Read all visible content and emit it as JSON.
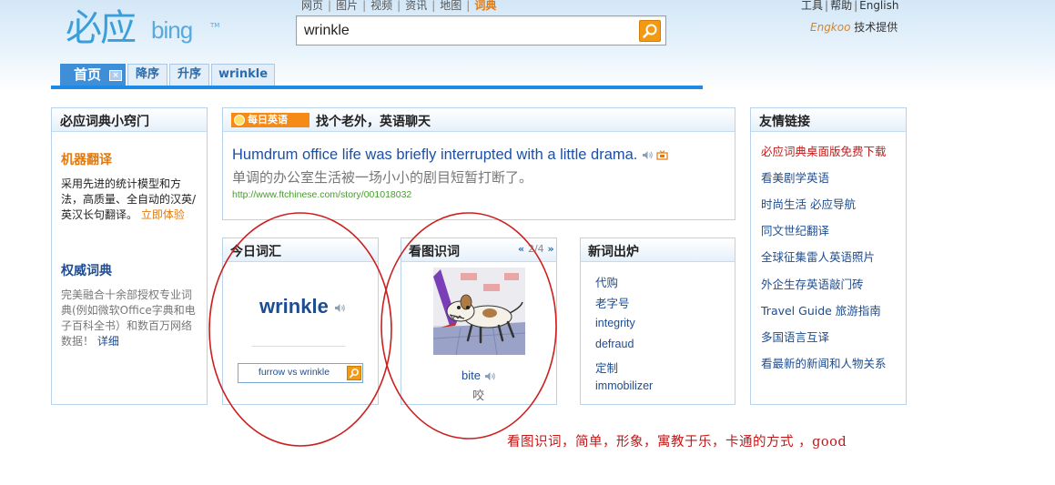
{
  "logo": {
    "cn": "必应",
    "en": "bing",
    "tm": "TM"
  },
  "nav": {
    "items": [
      {
        "label": "网页"
      },
      {
        "label": "图片"
      },
      {
        "label": "视频"
      },
      {
        "label": "资讯"
      },
      {
        "label": "地图"
      },
      {
        "label": "词典"
      }
    ],
    "active_index": 5
  },
  "search": {
    "value": "wrinkle"
  },
  "top_right": {
    "tools": "工具",
    "help": "帮助",
    "english": "English"
  },
  "provider": {
    "brand": "Engkoo",
    "text": "技术提供"
  },
  "tabs": {
    "home": "首页",
    "close": "×",
    "desc": "降序",
    "asc": "升序",
    "word": "wrinkle"
  },
  "left_panel": {
    "title": "必应词典小窍门",
    "mt_title": "机器翻译",
    "mt_desc": "采用先进的统计模型和方法，高质量、全自动的汉英/英汉长句翻译。",
    "mt_link": "立即体验",
    "auth_title": "权威词典",
    "auth_desc": "完美融合十余部授权专业词典(例如微软Office字典和电子百科全书）和数百万网络数据！",
    "auth_link": "详细"
  },
  "daily": {
    "badge": "每日英语",
    "title": "找个老外，英语聊天",
    "sentence_en": "Humdrum office life was briefly interrupted with a little drama.",
    "sentence_cn": "单调的办公室生活被一场小小的剧目短暂打断了。",
    "source_url": "http://www.ftchinese.com/story/001018032"
  },
  "word_today": {
    "title": "今日词汇",
    "word": "wrinkle",
    "compare": "furrow vs wrinkle"
  },
  "picture_word": {
    "title": "看图识词",
    "pager_prev": "«",
    "pager_num": "2/4",
    "pager_next": "»",
    "word": "bite",
    "cn": "咬"
  },
  "new_words": {
    "title": "新词出炉",
    "items": [
      "代购",
      "老字号",
      "integrity",
      "defraud",
      "定制",
      "immobilizer"
    ]
  },
  "links": {
    "title": "友情链接",
    "items": [
      "必应词典桌面版免费下载",
      "看美剧学英语",
      "时尚生活 必应导航",
      "同文世纪翻译",
      "全球征集雷人英语照片",
      "外企生存英语敲门砖",
      "Travel Guide 旅游指南",
      "多国语言互译",
      "看最新的新闻和人物关系"
    ]
  },
  "annotation": {
    "text": "看图识词，简单，形象，寓教于乐，卡通的方式 ，good",
    "color": "#c01818"
  },
  "colors": {
    "accent_blue": "#1c8ae6",
    "orange": "#f39a14",
    "link_blue": "#1e4c8f",
    "highlight_red": "#c21b1b"
  },
  "icons": [
    "search-icon",
    "speaker-icon",
    "video-icon",
    "sun-icon",
    "close-icon"
  ]
}
